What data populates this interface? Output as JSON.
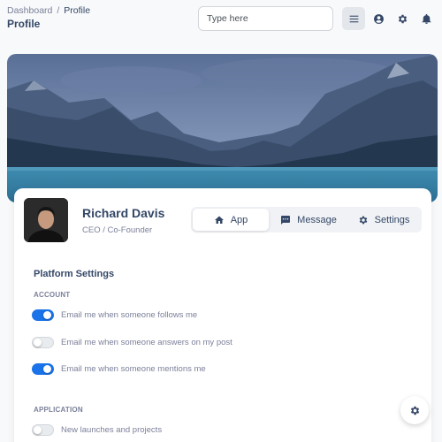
{
  "breadcrumb": {
    "root": "Dashboard",
    "separator": "/",
    "current": "Profile"
  },
  "page_title": "Profile",
  "search": {
    "placeholder": "Type here"
  },
  "nav_icons": [
    "menu-icon",
    "account-circle-icon",
    "gear-icon",
    "bell-icon"
  ],
  "profile": {
    "name": "Richard Davis",
    "role": "CEO / Co-Founder"
  },
  "tabs": [
    {
      "label": "App",
      "icon": "home-icon",
      "active": true
    },
    {
      "label": "Message",
      "icon": "chat-icon",
      "active": false
    },
    {
      "label": "Settings",
      "icon": "gear-icon",
      "active": false
    }
  ],
  "platform_settings": {
    "title": "Platform Settings",
    "account": {
      "label": "ACCOUNT",
      "items": [
        {
          "label": "Email me when someone follows me",
          "enabled": true
        },
        {
          "label": "Email me when someone answers on my post",
          "enabled": false
        },
        {
          "label": "Email me when someone mentions me",
          "enabled": true
        }
      ]
    },
    "application": {
      "label": "APPLICATION",
      "items": [
        {
          "label": "New launches and projects",
          "enabled": false
        }
      ]
    }
  },
  "colors": {
    "accent": "#1a73e8",
    "text": "#344767",
    "muted": "#7b809a"
  }
}
